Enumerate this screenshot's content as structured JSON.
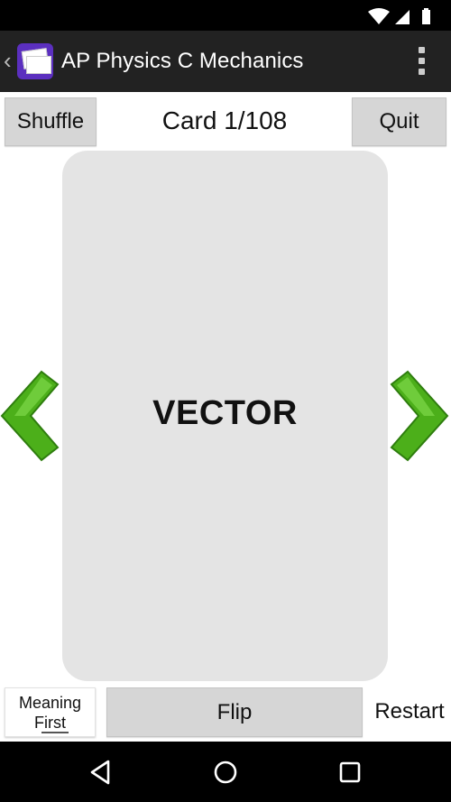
{
  "app": {
    "title": "AP Physics C Mechanics"
  },
  "toolbar": {
    "shuffle_label": "Shuffle",
    "card_counter": "Card 1/108",
    "quit_label": "Quit"
  },
  "card": {
    "term": "VECTOR",
    "color": "#e4e4e4"
  },
  "controls": {
    "meaning_first_line1": "Meaning",
    "meaning_first_line2": "First",
    "flip_label": "Flip",
    "restart_label": "Restart"
  },
  "colors": {
    "arrow_green": "#4caf1a",
    "action_bar": "#222222",
    "app_icon": "#5b2fbf"
  },
  "icons": {
    "back": "chevron-left-icon",
    "overflow": "more-vertical-icon",
    "prev": "green-arrow-left-icon",
    "next": "green-arrow-right-icon",
    "nav_back": "triangle-back-icon",
    "nav_home": "circle-home-icon",
    "nav_recents": "square-recents-icon"
  }
}
